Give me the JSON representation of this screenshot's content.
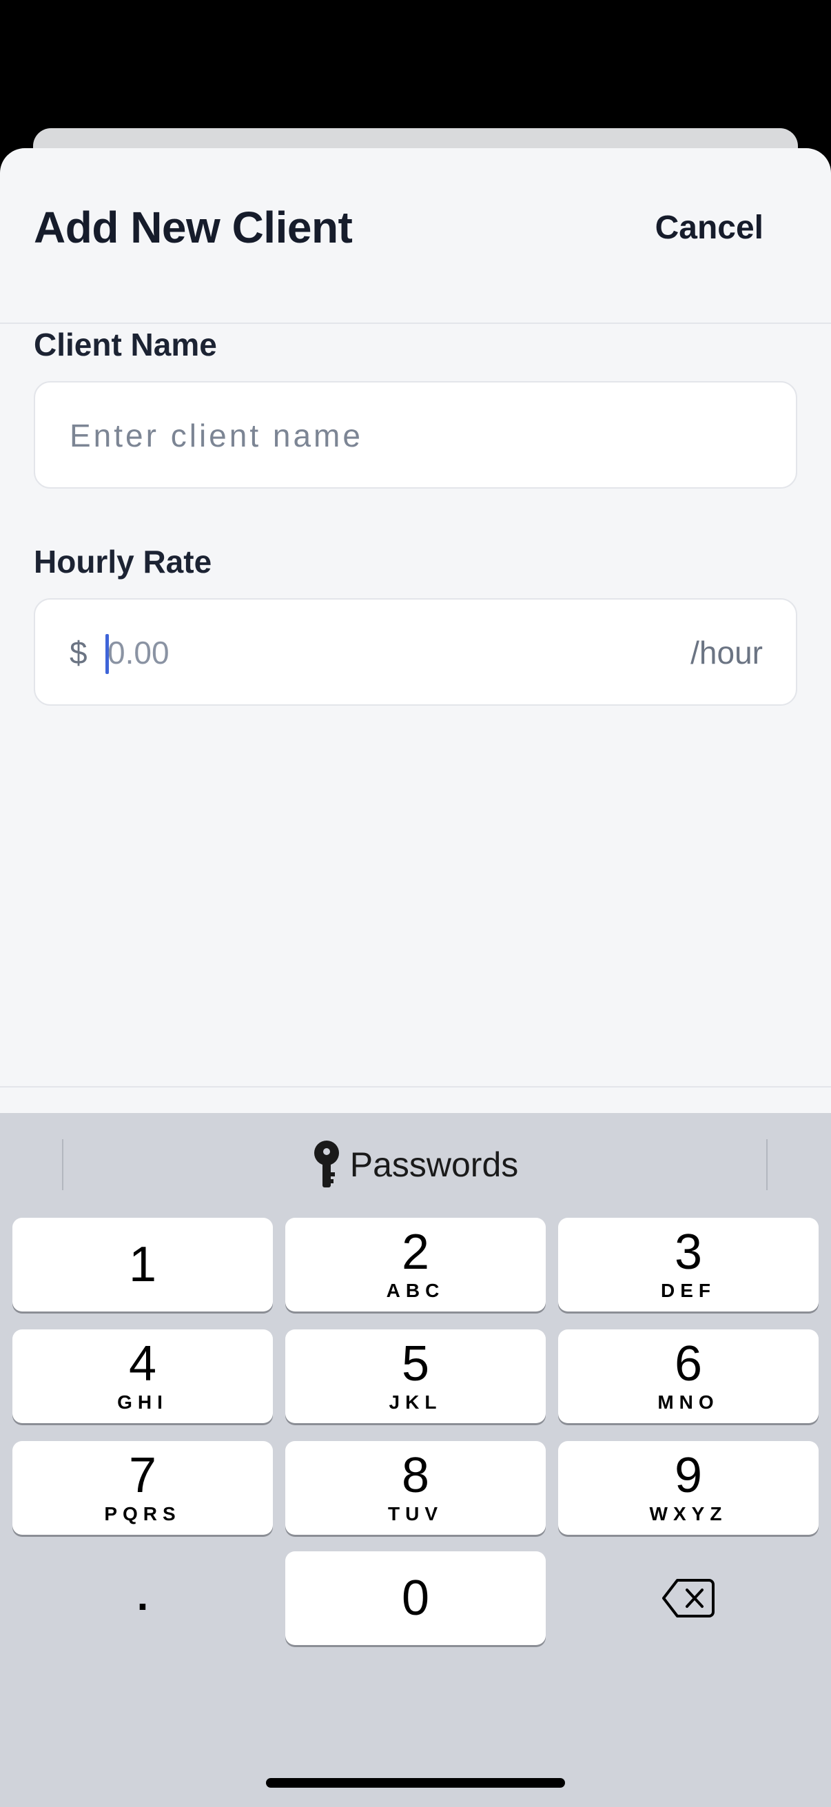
{
  "header": {
    "title": "Add New Client",
    "cancel_label": "Cancel"
  },
  "form": {
    "client_name": {
      "label": "Client Name",
      "placeholder": "Enter client name"
    },
    "hourly_rate": {
      "label": "Hourly Rate",
      "currency": "$",
      "placeholder": "0.00",
      "unit": "/hour"
    }
  },
  "keyboard": {
    "passwords_label": "Passwords",
    "keys": [
      {
        "num": "1",
        "letters": ""
      },
      {
        "num": "2",
        "letters": "ABC"
      },
      {
        "num": "3",
        "letters": "DEF"
      },
      {
        "num": "4",
        "letters": "GHI"
      },
      {
        "num": "5",
        "letters": "JKL"
      },
      {
        "num": "6",
        "letters": "MNO"
      },
      {
        "num": "7",
        "letters": "PQRS"
      },
      {
        "num": "8",
        "letters": "TUV"
      },
      {
        "num": "9",
        "letters": "WXYZ"
      },
      {
        "num": "0",
        "letters": ""
      }
    ],
    "decimal_label": ".",
    "delete_icon": "backspace-icon"
  }
}
